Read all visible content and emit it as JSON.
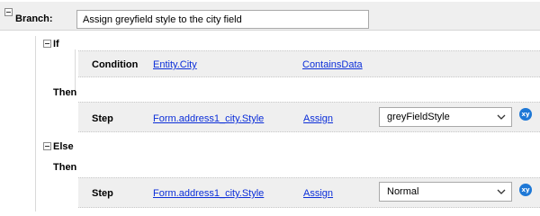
{
  "branch": {
    "label": "Branch:",
    "value": "Assign greyfield style to the city field"
  },
  "if_block": {
    "label": "If",
    "condition": {
      "label": "Condition",
      "field": "Entity.City",
      "operator": "ContainsData"
    }
  },
  "then1": {
    "label": "Then",
    "step": {
      "label": "Step",
      "field": "Form.address1_city.Style",
      "action": "Assign",
      "value": "greyFieldStyle"
    }
  },
  "else_block": {
    "label": "Else"
  },
  "then2": {
    "label": "Then",
    "step": {
      "label": "Step",
      "field": "Form.address1_city.Style",
      "action": "Assign",
      "value": "Normal"
    }
  },
  "icons": {
    "expression": "xy",
    "accent": "#1e78d6"
  }
}
